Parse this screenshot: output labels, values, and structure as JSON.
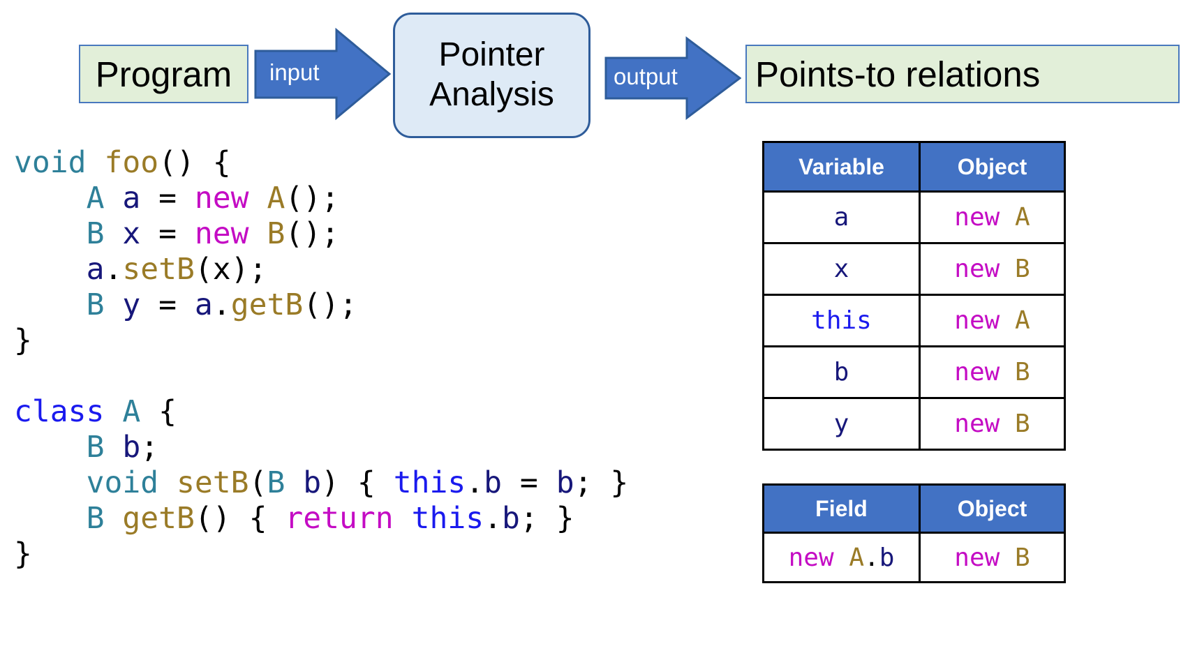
{
  "flow": {
    "program_box": {
      "label": "Program",
      "fill": "#E2EFD9",
      "border": "#4878BE"
    },
    "input_arrow": {
      "label": "input",
      "fill": "#4272C4"
    },
    "analysis_box": {
      "line1": "Pointer",
      "line2": "Analysis",
      "fill": "#DEEAF6",
      "border": "#2E5C9A"
    },
    "output_arrow": {
      "label": "output",
      "fill": "#4272C4"
    },
    "result_box": {
      "label": "Points-to relations",
      "fill": "#E2EFD9",
      "border": "#4878BE"
    }
  },
  "code": {
    "language": "java",
    "colors": {
      "type": "#2E8099",
      "method": "#9A7B27",
      "variable": "#17177A",
      "keyword": "#C40CC4",
      "class_this": "#1A1AEE",
      "punctuation": "#000000"
    },
    "lines": [
      {
        "tokens": [
          {
            "t": "void",
            "c": "type"
          },
          {
            "t": " ",
            "c": "punct"
          },
          {
            "t": "foo",
            "c": "method"
          },
          {
            "t": "() {",
            "c": "punct"
          }
        ]
      },
      {
        "tokens": [
          {
            "t": "    ",
            "c": "punct"
          },
          {
            "t": "A",
            "c": "type"
          },
          {
            "t": " ",
            "c": "punct"
          },
          {
            "t": "a",
            "c": "var"
          },
          {
            "t": " = ",
            "c": "punct"
          },
          {
            "t": "new",
            "c": "kw"
          },
          {
            "t": " ",
            "c": "punct"
          },
          {
            "t": "A",
            "c": "method"
          },
          {
            "t": "();",
            "c": "punct"
          }
        ]
      },
      {
        "tokens": [
          {
            "t": "    ",
            "c": "punct"
          },
          {
            "t": "B",
            "c": "type"
          },
          {
            "t": " ",
            "c": "punct"
          },
          {
            "t": "x",
            "c": "var"
          },
          {
            "t": " = ",
            "c": "punct"
          },
          {
            "t": "new",
            "c": "kw"
          },
          {
            "t": " ",
            "c": "punct"
          },
          {
            "t": "B",
            "c": "method"
          },
          {
            "t": "();",
            "c": "punct"
          }
        ]
      },
      {
        "tokens": [
          {
            "t": "    ",
            "c": "punct"
          },
          {
            "t": "a",
            "c": "var"
          },
          {
            "t": ".",
            "c": "punct"
          },
          {
            "t": "setB",
            "c": "method"
          },
          {
            "t": "(",
            "c": "punct"
          },
          {
            "t": "x",
            "c": "punct"
          },
          {
            "t": ");",
            "c": "punct"
          }
        ]
      },
      {
        "tokens": [
          {
            "t": "    ",
            "c": "punct"
          },
          {
            "t": "B",
            "c": "type"
          },
          {
            "t": " ",
            "c": "punct"
          },
          {
            "t": "y",
            "c": "var"
          },
          {
            "t": " = ",
            "c": "punct"
          },
          {
            "t": "a",
            "c": "var"
          },
          {
            "t": ".",
            "c": "punct"
          },
          {
            "t": "getB",
            "c": "method"
          },
          {
            "t": "();",
            "c": "punct"
          }
        ]
      },
      {
        "tokens": [
          {
            "t": "}",
            "c": "punct"
          }
        ]
      },
      {
        "tokens": [
          {
            "t": " ",
            "c": "punct"
          }
        ]
      },
      {
        "tokens": [
          {
            "t": "class",
            "c": "class"
          },
          {
            "t": " ",
            "c": "punct"
          },
          {
            "t": "A",
            "c": "type"
          },
          {
            "t": " {",
            "c": "punct"
          }
        ]
      },
      {
        "tokens": [
          {
            "t": "    ",
            "c": "punct"
          },
          {
            "t": "B",
            "c": "type"
          },
          {
            "t": " ",
            "c": "punct"
          },
          {
            "t": "b",
            "c": "var"
          },
          {
            "t": ";",
            "c": "punct"
          }
        ]
      },
      {
        "tokens": [
          {
            "t": "    ",
            "c": "punct"
          },
          {
            "t": "void",
            "c": "type"
          },
          {
            "t": " ",
            "c": "punct"
          },
          {
            "t": "setB",
            "c": "method"
          },
          {
            "t": "(",
            "c": "punct"
          },
          {
            "t": "B",
            "c": "type"
          },
          {
            "t": " ",
            "c": "punct"
          },
          {
            "t": "b",
            "c": "var"
          },
          {
            "t": ") { ",
            "c": "punct"
          },
          {
            "t": "this",
            "c": "this"
          },
          {
            "t": ".",
            "c": "punct"
          },
          {
            "t": "b",
            "c": "var"
          },
          {
            "t": " = ",
            "c": "punct"
          },
          {
            "t": "b",
            "c": "var"
          },
          {
            "t": "; }",
            "c": "punct"
          }
        ]
      },
      {
        "tokens": [
          {
            "t": "    ",
            "c": "punct"
          },
          {
            "t": "B",
            "c": "type"
          },
          {
            "t": " ",
            "c": "punct"
          },
          {
            "t": "getB",
            "c": "method"
          },
          {
            "t": "() { ",
            "c": "punct"
          },
          {
            "t": "return",
            "c": "kw"
          },
          {
            "t": " ",
            "c": "punct"
          },
          {
            "t": "this",
            "c": "this"
          },
          {
            "t": ".",
            "c": "punct"
          },
          {
            "t": "b",
            "c": "var"
          },
          {
            "t": "; }",
            "c": "punct"
          }
        ]
      },
      {
        "tokens": [
          {
            "t": "}",
            "c": "punct"
          }
        ]
      }
    ]
  },
  "variable_object_table": {
    "header_fill": "#4272C4",
    "columns": [
      "Variable",
      "Object"
    ],
    "rows": [
      {
        "variable": {
          "t": "a",
          "c": "var"
        },
        "object": [
          {
            "t": "new",
            "c": "kw"
          },
          {
            "t": " ",
            "c": "punct"
          },
          {
            "t": "A",
            "c": "method"
          }
        ]
      },
      {
        "variable": {
          "t": "x",
          "c": "var"
        },
        "object": [
          {
            "t": "new",
            "c": "kw"
          },
          {
            "t": " ",
            "c": "punct"
          },
          {
            "t": "B",
            "c": "method"
          }
        ]
      },
      {
        "variable": {
          "t": "this",
          "c": "this"
        },
        "object": [
          {
            "t": "new",
            "c": "kw"
          },
          {
            "t": " ",
            "c": "punct"
          },
          {
            "t": "A",
            "c": "method"
          }
        ]
      },
      {
        "variable": {
          "t": "b",
          "c": "var"
        },
        "object": [
          {
            "t": "new",
            "c": "kw"
          },
          {
            "t": " ",
            "c": "punct"
          },
          {
            "t": "B",
            "c": "method"
          }
        ]
      },
      {
        "variable": {
          "t": "y",
          "c": "var"
        },
        "object": [
          {
            "t": "new",
            "c": "kw"
          },
          {
            "t": " ",
            "c": "punct"
          },
          {
            "t": "B",
            "c": "method"
          }
        ]
      }
    ]
  },
  "field_object_table": {
    "header_fill": "#4272C4",
    "columns": [
      "Field",
      "Object"
    ],
    "rows": [
      {
        "field": [
          {
            "t": "new",
            "c": "kw"
          },
          {
            "t": " ",
            "c": "punct"
          },
          {
            "t": "A",
            "c": "method"
          },
          {
            "t": ".",
            "c": "punct"
          },
          {
            "t": "b",
            "c": "var"
          }
        ],
        "object": [
          {
            "t": "new",
            "c": "kw"
          },
          {
            "t": " ",
            "c": "punct"
          },
          {
            "t": "B",
            "c": "method"
          }
        ]
      }
    ]
  }
}
